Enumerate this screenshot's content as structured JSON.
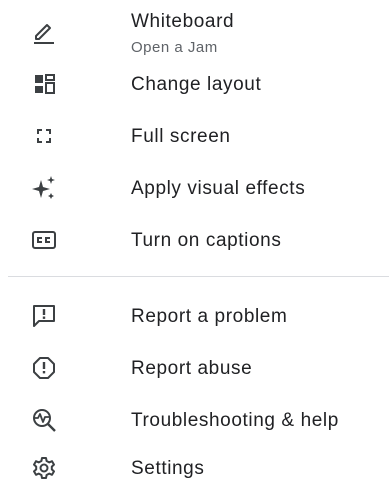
{
  "menu": {
    "whiteboard": {
      "label": "Whiteboard",
      "sublabel": "Open a Jam",
      "icon": "pencil-icon"
    },
    "change_layout": {
      "label": "Change layout",
      "icon": "layout-icon"
    },
    "full_screen": {
      "label": "Full screen",
      "icon": "fullscreen-icon"
    },
    "visual_effects": {
      "label": "Apply visual effects",
      "icon": "sparkle-icon"
    },
    "captions": {
      "label": "Turn on captions",
      "icon": "closed-captions-icon"
    },
    "report_problem": {
      "label": "Report a problem",
      "icon": "feedback-icon"
    },
    "report_abuse": {
      "label": "Report abuse",
      "icon": "alert-icon"
    },
    "troubleshooting": {
      "label": "Troubleshooting & help",
      "icon": "diagnostics-icon"
    },
    "settings": {
      "label": "Settings",
      "icon": "gear-icon"
    }
  },
  "colors": {
    "text": "#202124",
    "secondary_text": "#5f6368",
    "icon": "#3c4043",
    "divider": "#dadce0"
  }
}
